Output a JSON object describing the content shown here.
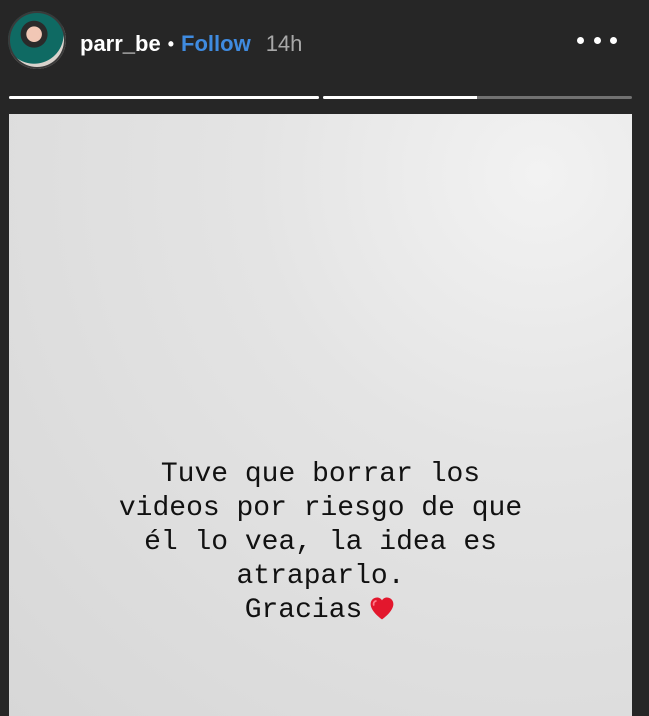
{
  "header": {
    "username": "parr_be",
    "separator": "•",
    "follow_label": "Follow",
    "time_ago": "14h",
    "more_icon": "more-horizontal-icon"
  },
  "progress": {
    "segments": [
      {
        "fraction": 1.0
      },
      {
        "fraction": 0.5
      }
    ]
  },
  "story": {
    "lines": [
      "Tuve que borrar los",
      "videos por riesgo de que",
      "él lo vea, la idea es",
      "atraparlo.",
      "Gracias"
    ],
    "emoji": "red-heart-icon",
    "heart_color": "#e3172d"
  },
  "colors": {
    "background": "#262626",
    "follow_blue": "#3f8be0",
    "time_gray": "#a8a8a8"
  }
}
